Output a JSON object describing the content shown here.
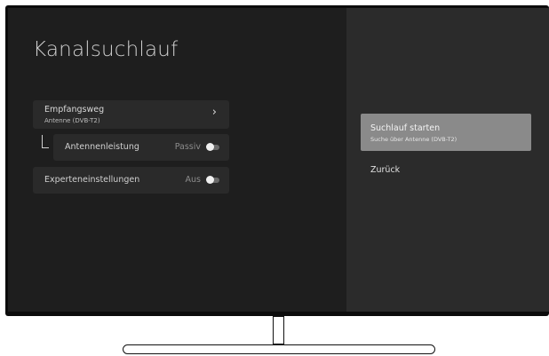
{
  "screen": {
    "title": "Kanalsuchlauf"
  },
  "settings": {
    "reception": {
      "title": "Empfangsweg",
      "subtitle": "Antenne (DVB-T2)",
      "icon": "chevron-right-icon",
      "chevron": "›"
    },
    "antenna_power": {
      "label": "Antennenleistung",
      "value": "Passiv",
      "toggle_on": false
    },
    "expert": {
      "label": "Experteneinstellungen",
      "value": "Aus",
      "toggle_on": false
    }
  },
  "actions": {
    "start": {
      "title": "Suchlauf starten",
      "subtitle": "Suche über Antenne (DVB-T2)"
    },
    "back": {
      "title": "Zurück"
    }
  },
  "colors": {
    "background": "#1e1e1e",
    "panel": "#2b2b2b",
    "row": "#2a2a2a",
    "highlight": "#8a8a8a"
  }
}
